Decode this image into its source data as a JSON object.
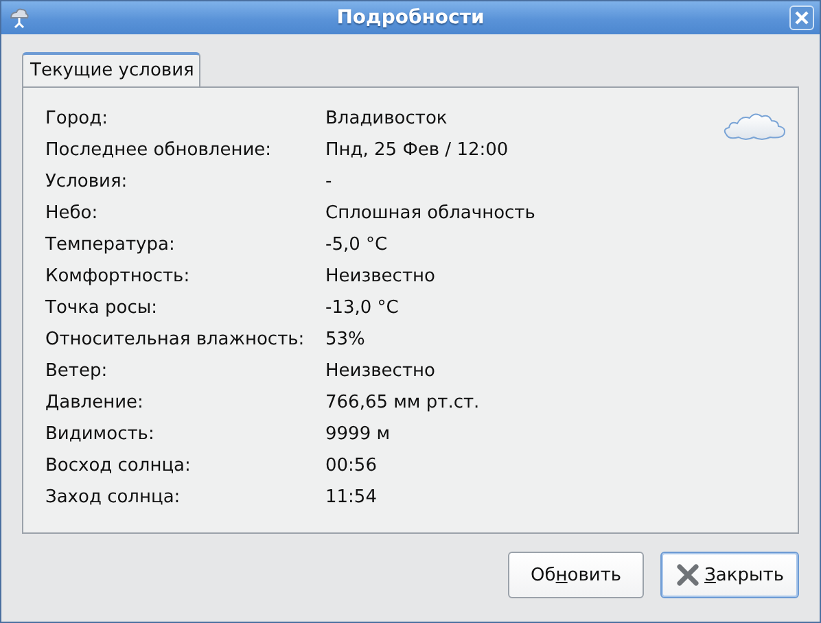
{
  "window": {
    "title": "Подробности"
  },
  "tabs": [
    {
      "label": "Текущие условия",
      "selected": true
    }
  ],
  "details": [
    {
      "label": "Город:",
      "value": "Владивосток"
    },
    {
      "label": "Последнее обновление:",
      "value": "Пнд, 25 Фев / 12:00"
    },
    {
      "label": "Условия:",
      "value": "-"
    },
    {
      "label": "Небо:",
      "value": "Сплошная облачность"
    },
    {
      "label": "Температура:",
      "value": "-5,0 °C"
    },
    {
      "label": "Комфортность:",
      "value": "Неизвестно"
    },
    {
      "label": "Точка росы:",
      "value": "-13,0 °C"
    },
    {
      "label": "Относительная влажность:",
      "value": "53%"
    },
    {
      "label": "Ветер:",
      "value": "Неизвестно"
    },
    {
      "label": "Давление:",
      "value": "766,65 мм рт.ст."
    },
    {
      "label": "Видимость:",
      "value": "9999 м"
    },
    {
      "label": "Восход солнца:",
      "value": "00:56"
    },
    {
      "label": "Заход солнца:",
      "value": "11:54"
    }
  ],
  "buttons": [
    {
      "kind": "refresh",
      "before": "Об",
      "key": "н",
      "after": "овить",
      "focused": false
    },
    {
      "kind": "close",
      "key": "З",
      "after": "акрыть",
      "focused": true
    }
  ]
}
